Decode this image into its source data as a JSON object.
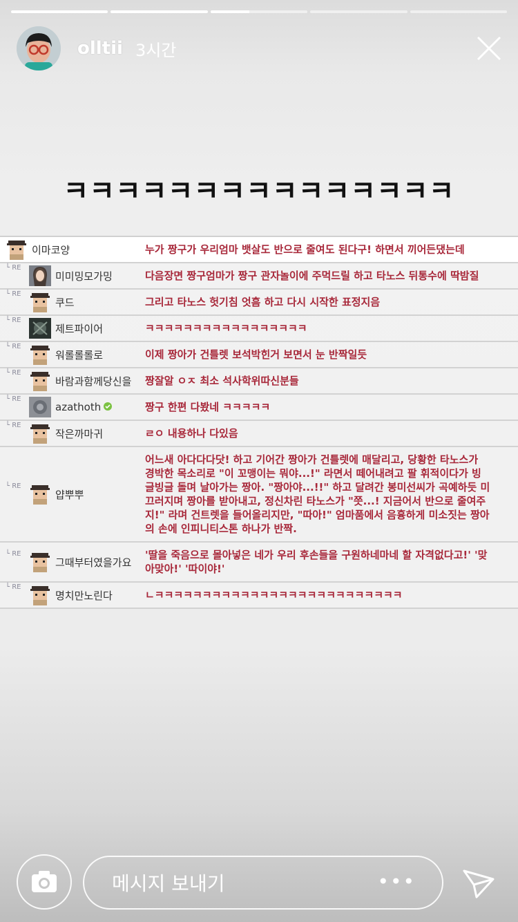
{
  "story": {
    "segments": [
      1,
      1,
      0.4,
      0,
      0
    ],
    "username": "olltii",
    "time": "3시간",
    "caption": "ㅋㅋㅋㅋㅋㅋㅋㅋㅋㅋㅋㅋㅋㅋㅋ"
  },
  "comments": [
    {
      "nick": "이마코양",
      "text": "누가 짱구가 우리엄마 뱃살도 반으로 줄여도 된다구! 하면서 끼어든댔는데",
      "reply": false,
      "avatar": "pixel"
    },
    {
      "nick": "미미밍모가밍",
      "text": "다음장면 짱구엄마가 짱구 관자놀이에 주먹드릴 하고 타노스 뒤통수에 딱밤질",
      "reply": true,
      "avatar": "photo"
    },
    {
      "nick": "쿠드",
      "text": "그리고 타노스 헛기침 엇흠 하고 다시 시작한 표정지음",
      "reply": true,
      "avatar": "pixel"
    },
    {
      "nick": "제트파이어",
      "text": "ㅋㅋㅋㅋㅋㅋㅋㅋㅋㅋㅋㅋㅋㅋㅋㅋㅋ",
      "reply": true,
      "avatar": "dark"
    },
    {
      "nick": "워롤롤롤로",
      "text": "이제 짱아가 건틀렛 보석박힌거 보면서 눈 반짝일듯",
      "reply": true,
      "avatar": "pixel"
    },
    {
      "nick": "바람과함께당신을",
      "text": "짱잘알 ㅇㅈ 최소 석사학위따신분들",
      "reply": true,
      "avatar": "pixel"
    },
    {
      "nick": "azathoth",
      "text": "짱구 한편 다봤네 ㅋㅋㅋㅋㅋ",
      "reply": true,
      "avatar": "gray",
      "badge": true
    },
    {
      "nick": "작은까마귀",
      "text": "ㄹㅇ 내용하나 다있음",
      "reply": true,
      "avatar": "pixel"
    },
    {
      "nick": "얍뿌뿌",
      "text": "어느새 아다다다닷! 하고 기어간 짱아가 건틀렛에 매달리고, 당황한 타노스가 경박한 목소리로 \"이 꼬맹이는 뭐야...!\" 라면서 떼어내려고 팔 휘적이다가 빙글빙글 돌며 날아가는 짱아. \"짱아야...!!\" 하고 달려간 봉미선씨가 곡예하듯 미끄러지며 짱아를 받아내고, 정신차린 타노스가 \"쯧...! 지금어서 반으로 줄여주지!\" 라며 건트렛을 들어올리지만, \"따아!\" 엄마품에서 음흉하게 미소짓는 짱아의 손에 인피니티스톤 하나가 반짝.",
      "reply": true,
      "avatar": "pixel"
    },
    {
      "nick": "그때부터였을가요",
      "text": "'딸을 죽음으로 몰아넣은 네가 우리 후손들을 구원하네마네 할 자격없다고!' '맞아맞아!' '따이야!'",
      "reply": true,
      "avatar": "pixel"
    },
    {
      "nick": "명치만노린다",
      "text": "ㄴㅋㅋㅋㅋㅋㅋㅋㅋㅋㅋㅋㅋㅋㅋㅋㅋㅋㅋㅋㅋㅋㅋㅋㅋㅋㅋ",
      "reply": true,
      "avatar": "pixel"
    }
  ],
  "reply_tag": "RE",
  "bottom": {
    "placeholder": "메시지 보내기",
    "more": "•••"
  },
  "icons": {
    "close": "close-icon",
    "camera": "camera-icon",
    "send": "send-icon"
  }
}
